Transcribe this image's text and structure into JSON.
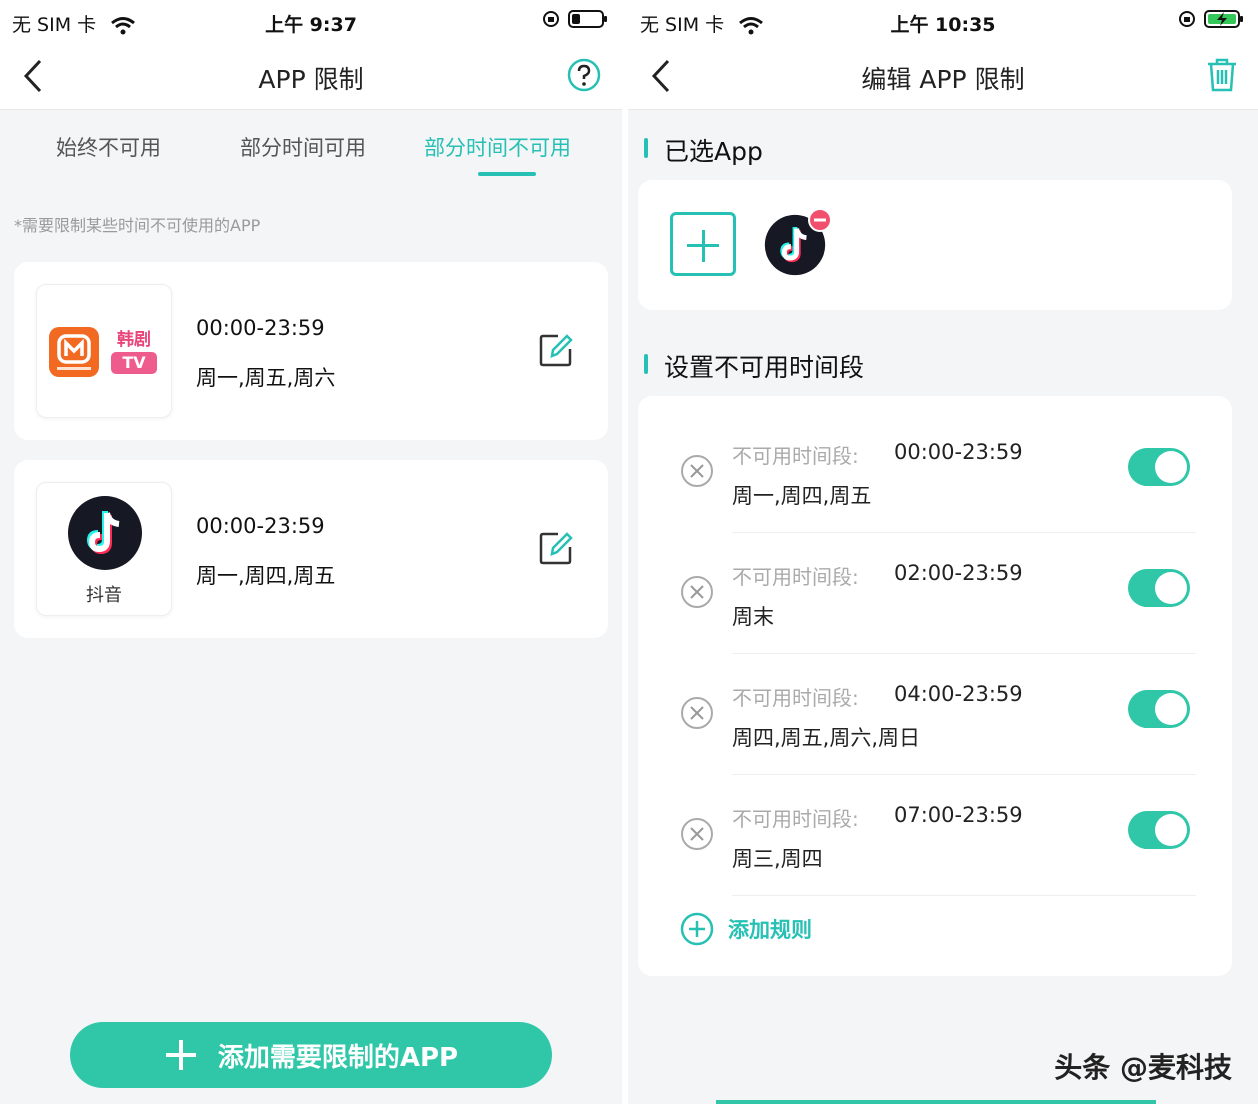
{
  "left": {
    "status": {
      "carrier": "无 SIM 卡",
      "time": "上午 9:37"
    },
    "nav": {
      "title": "APP 限制"
    },
    "tabs": [
      {
        "label": "始终不可用",
        "active": false
      },
      {
        "label": "部分时间可用",
        "active": false
      },
      {
        "label": "部分时间不可用",
        "active": true
      }
    ],
    "hint": "*需要限制某些时间不可使用的APP",
    "cards": [
      {
        "time": "00:00-23:59",
        "days": "周一,周五,周六",
        "apps": [
          "芒果TV",
          "韩剧TV"
        ],
        "app_badge_text": "韩剧",
        "app_badge_text2": "TV"
      },
      {
        "time": "00:00-23:59",
        "days": "周一,周四,周五",
        "apps": [
          "抖音"
        ],
        "app_label": "抖音"
      }
    ],
    "add_button": {
      "label": "添加需要限制的APP"
    }
  },
  "right": {
    "status": {
      "carrier": "无 SIM 卡",
      "time": "上午 10:35"
    },
    "nav": {
      "title": "编辑 APP 限制"
    },
    "selected_section": {
      "title": "已选App"
    },
    "rules_section": {
      "title": "设置不可用时间段"
    },
    "rules": [
      {
        "label": "不可用时间段:",
        "time": "00:00-23:59",
        "days": "周一,周四,周五",
        "enabled": true
      },
      {
        "label": "不可用时间段:",
        "time": "02:00-23:59",
        "days": "周末",
        "enabled": true
      },
      {
        "label": "不可用时间段:",
        "time": "04:00-23:59",
        "days": "周四,周五,周六,周日",
        "enabled": true
      },
      {
        "label": "不可用时间段:",
        "time": "07:00-23:59",
        "days": "周三,周四",
        "enabled": true
      }
    ],
    "add_rule": {
      "label": "添加规则"
    },
    "watermark": "头条 @麦科技"
  },
  "colors": {
    "accent": "#26c0b4",
    "button": "#2fc7a8"
  }
}
